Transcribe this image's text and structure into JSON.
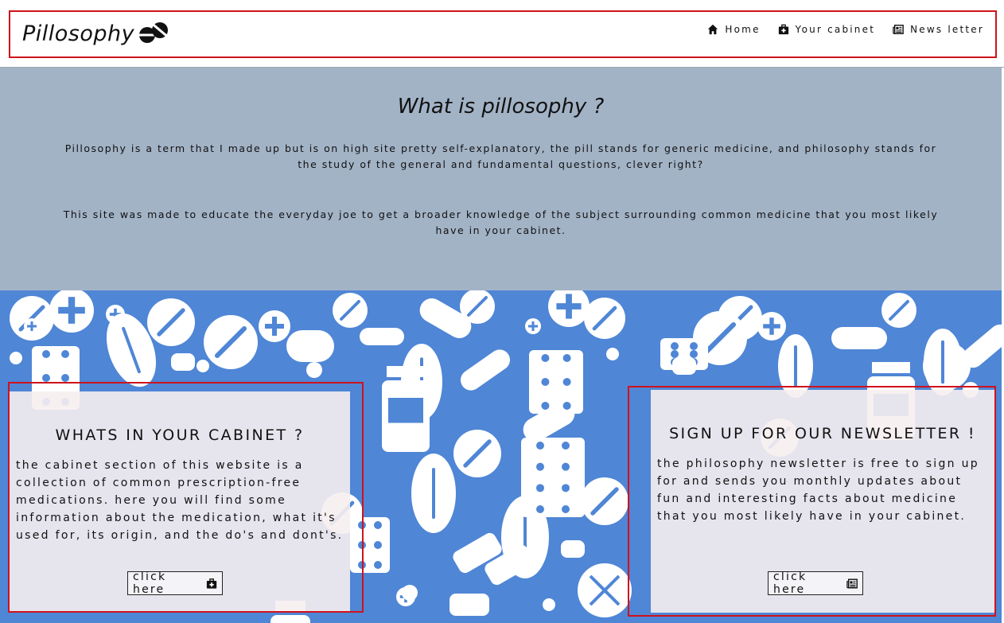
{
  "header": {
    "brand": "Pillosophy",
    "nav": [
      {
        "label": "Home",
        "icon": "home-icon"
      },
      {
        "label": "Your cabinet",
        "icon": "medkit-icon"
      },
      {
        "label": "News letter",
        "icon": "newspaper-icon"
      }
    ]
  },
  "intro": {
    "title": "What is pillosophy ?",
    "paragraph1": "Pillosophy is a term that I made up but is on high site pretty self-explanatory, the pill stands for generic medicine, and philosophy stands for the study of the general and fundamental questions, clever right?",
    "paragraph2": "This site was made to educate the everyday joe to get a broader knowledge of the subject surrounding common medicine that you most likely have in your cabinet."
  },
  "cards": {
    "cabinet": {
      "title": "WHATS IN YOUR CABINET ?",
      "text": "the cabinet section of this website is a collection of common prescription-free medications. here you will find some information about the medication, what it's used for, its origin, and the do's and dont's.",
      "button": "click here",
      "icon": "medkit-icon"
    },
    "newsletter": {
      "title": "SIGN UP FOR OUR NEWSLETTER !",
      "text": "the philosophy newsletter is free to sign up for and sends you monthly updates about fun and interesting facts about medicine that you most likely have in your cabinet.",
      "button": "click here",
      "icon": "newspaper-icon"
    }
  },
  "colors": {
    "intro_background": "#a3b3c6",
    "pattern_background": "#4f86d6",
    "highlight_frame": "#d0121b"
  }
}
